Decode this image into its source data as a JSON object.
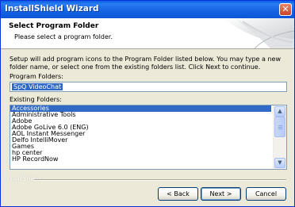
{
  "window": {
    "title": "InstallShield Wizard",
    "close_icon": "close-icon"
  },
  "header": {
    "title": "Select Program Folder",
    "subtitle": "Please select a program folder."
  },
  "description": "Setup will add program icons to the Program Folder listed below.  You may type a new folder name, or select one from the existing folders list.  Click Next to continue.",
  "program_folder": {
    "label": "Program Folders:",
    "value": "SpQ VideoChat"
  },
  "existing_folders": {
    "label": "Existing Folders:",
    "items": [
      "Accessories",
      "Administrative Tools",
      "Adobe",
      "Adobe GoLive 6.0 (ENG)",
      "AOL Instant Messenger",
      "Delfo IntelliMover",
      "Games",
      "hp center",
      "HP RecordNow"
    ],
    "selected": "Accessories"
  },
  "footer": {
    "brand": "InstallShield",
    "back_label": "< Back",
    "next_label": "Next >",
    "cancel_label": "Cancel"
  },
  "colors": {
    "titlebar": "#0a5fe7",
    "selection": "#316ac5",
    "dialog": "#ece9d8"
  }
}
